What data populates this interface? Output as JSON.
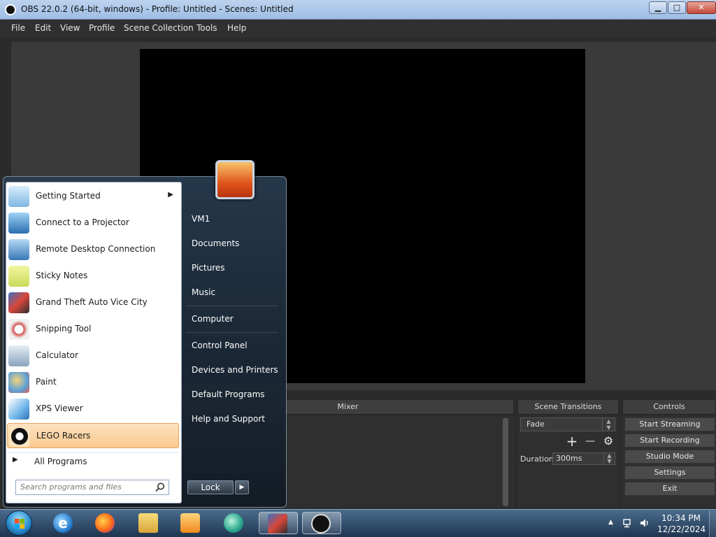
{
  "window": {
    "title": "OBS 22.0.2 (64-bit, windows) - Profile: Untitled - Scenes: Untitled",
    "minimize": "▁",
    "maximize": "□",
    "close": "✕"
  },
  "menubar": {
    "items": [
      "File",
      "Edit",
      "View",
      "Profile",
      "Scene Collection",
      "Tools",
      "Help"
    ]
  },
  "docks": {
    "mixer_title": "Mixer",
    "scene_transitions_title": "Scene Transitions",
    "controls_title": "Controls",
    "transition_value": "Fade",
    "add_icon": "+",
    "remove_icon": "—",
    "gear_icon": "⚙",
    "duration_label": "Duration",
    "duration_value": "300ms",
    "controls": [
      "Start Streaming",
      "Start Recording",
      "Studio Mode",
      "Settings",
      "Exit"
    ]
  },
  "start_menu": {
    "programs": [
      {
        "label": "Getting Started",
        "icon": "getting-started-icon",
        "has_submenu": true
      },
      {
        "label": "Connect to a Projector",
        "icon": "projector-icon"
      },
      {
        "label": "Remote Desktop Connection",
        "icon": "remote-desktop-icon"
      },
      {
        "label": "Sticky Notes",
        "icon": "sticky-notes-icon"
      },
      {
        "label": "Grand Theft Auto Vice City",
        "icon": "gta-icon"
      },
      {
        "label": "Snipping Tool",
        "icon": "snipping-tool-icon"
      },
      {
        "label": "Calculator",
        "icon": "calculator-icon"
      },
      {
        "label": "Paint",
        "icon": "paint-icon"
      },
      {
        "label": "XPS Viewer",
        "icon": "xps-viewer-icon"
      },
      {
        "label": "LEGO Racers",
        "icon": "lego-racers-icon",
        "selected": true
      }
    ],
    "all_programs": "All Programs",
    "search_placeholder": "Search programs and files",
    "right_items": [
      "VM1",
      "Documents",
      "Pictures",
      "Music",
      "Computer",
      "Control Panel",
      "Devices and Printers",
      "Default Programs",
      "Help and Support"
    ],
    "lock_label": "Lock",
    "submenu_arrow": "▶"
  },
  "taskbar": {
    "time": "10:34 PM",
    "date": "12/22/2024",
    "tray_chevron": "▲"
  },
  "colors": {
    "obs_bg": "#2b2b2b",
    "obs_panel": "#3e3e3e",
    "selected_program": "#f9c98e",
    "taskbar": "#1f3550"
  }
}
